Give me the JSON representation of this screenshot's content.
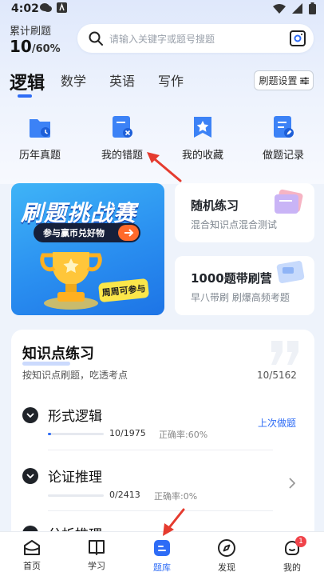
{
  "status_bar": {
    "time": "4:02"
  },
  "header": {
    "stat_label": "累计刷题",
    "stat_done": "10",
    "stat_total": "/60%"
  },
  "search": {
    "placeholder": "请输入关键字或题号搜题"
  },
  "tabs": [
    {
      "label": "逻辑",
      "active": true
    },
    {
      "label": "数学",
      "active": false
    },
    {
      "label": "英语",
      "active": false
    },
    {
      "label": "写作",
      "active": false
    }
  ],
  "settings_label": "刷题设置",
  "entries": [
    {
      "label": "历年真题",
      "icon": "calendar-folder-icon"
    },
    {
      "label": "我的错题",
      "icon": "wrong-questions-icon"
    },
    {
      "label": "我的收藏",
      "icon": "star-bookmark-icon"
    },
    {
      "label": "做题记录",
      "icon": "record-edit-icon"
    }
  ],
  "banner": {
    "title": "刷题挑战赛",
    "pill": "参与赢币兑好物",
    "tag": "周周可参与"
  },
  "cards": [
    {
      "title": "随机练习",
      "subtitle": "混合知识点混合测试"
    },
    {
      "title": "1000题带刷营",
      "subtitle": "早八带刷 刷爆高频考题"
    }
  ],
  "practice": {
    "title": "知识点练习",
    "subtitle": "按知识点刷题，吃透考点",
    "count": "10/5162",
    "categories": [
      {
        "name": "形式逻辑",
        "stat": "10/1975",
        "accuracy": "正确率:60%",
        "progress": 0.005,
        "last": "上次做题"
      },
      {
        "name": "论证推理",
        "stat": "0/2413",
        "accuracy": "正确率:0%",
        "progress": 0
      },
      {
        "name": "分析推理"
      }
    ]
  },
  "nav": [
    {
      "label": "首页",
      "icon": "home-icon",
      "active": false
    },
    {
      "label": "学习",
      "icon": "book-icon",
      "active": false
    },
    {
      "label": "题库",
      "icon": "question-bank-icon",
      "active": true
    },
    {
      "label": "发现",
      "icon": "compass-icon",
      "active": false
    },
    {
      "label": "我的",
      "icon": "profile-icon",
      "active": false,
      "badge": "1"
    }
  ],
  "colors": {
    "accent": "#2e6cf6",
    "badge": "#f0434a",
    "banner": "#2a8ff0"
  }
}
